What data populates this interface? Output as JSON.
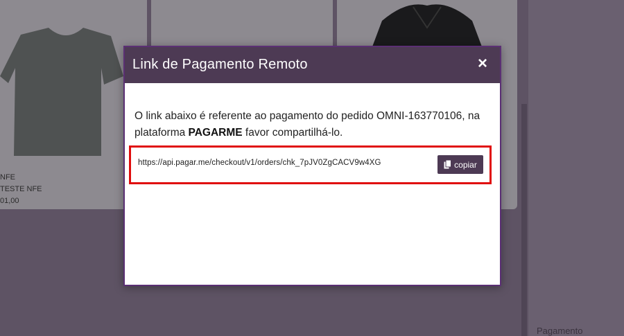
{
  "background": {
    "product_lines": [
      "NFE",
      "TESTE NFE",
      "01,00"
    ],
    "right_panel_text": "Pagamento"
  },
  "modal": {
    "title": "Link de Pagamento Remoto",
    "close_label": "×",
    "message_prefix": "O link abaixo é referente ao pagamento do pedido OMNI-163770106, na plataforma ",
    "platform": "PAGARME",
    "message_suffix": " favor compartilhá-lo.",
    "payment_url": "https://api.pagar.me/checkout/v1/orders/chk_7pJV0ZgCACV9w4XG",
    "copy_label": "copiar"
  },
  "colors": {
    "modal_header": "#4d3a54",
    "highlight_border": "#e00d0d",
    "overlay": "#5e5364"
  }
}
